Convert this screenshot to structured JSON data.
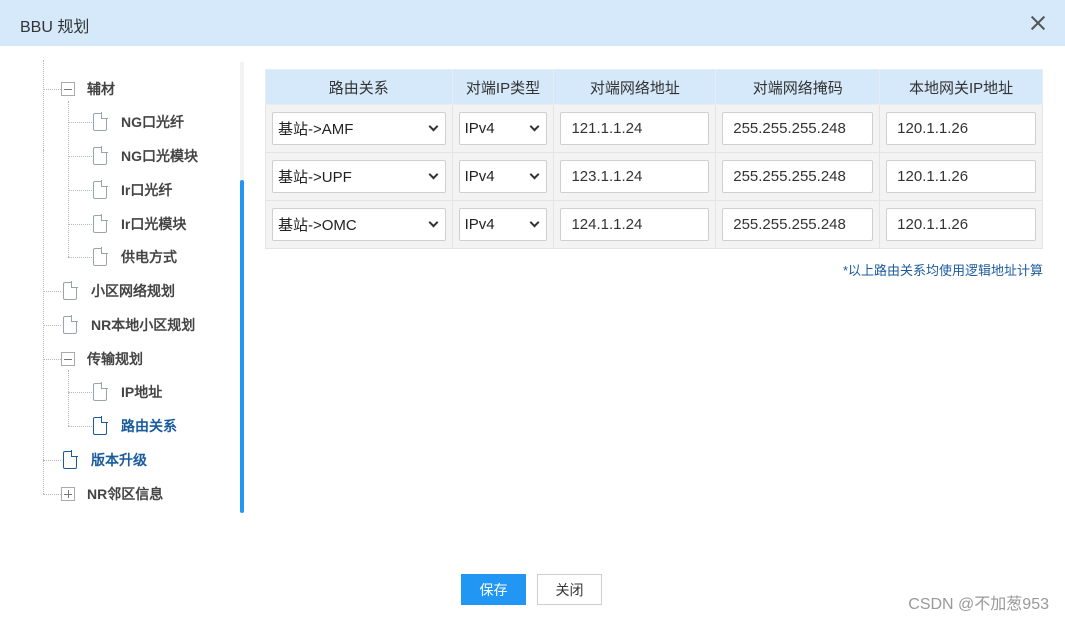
{
  "window": {
    "title": "BBU 规划"
  },
  "tree": {
    "items": [
      {
        "label": "辅材"
      },
      {
        "label": "NG口光纤"
      },
      {
        "label": "NG口光模块"
      },
      {
        "label": "Ir口光纤"
      },
      {
        "label": "Ir口光模块"
      },
      {
        "label": "供电方式"
      },
      {
        "label": "小区网络规划"
      },
      {
        "label": "NR本地小区规划"
      },
      {
        "label": "传输规划"
      },
      {
        "label": "IP地址"
      },
      {
        "label": "路由关系"
      },
      {
        "label": "版本升级"
      },
      {
        "label": "NR邻区信息"
      }
    ]
  },
  "table": {
    "headers": [
      "路由关系",
      "对端IP类型",
      "对端网络地址",
      "对端网络掩码",
      "本地网关IP地址"
    ],
    "rows": [
      {
        "route": "基站->AMF",
        "ip_type": "IPv4",
        "peer_addr": "121.1.1.24",
        "peer_mask": "255.255.255.248",
        "gateway": "120.1.1.26"
      },
      {
        "route": "基站->UPF",
        "ip_type": "IPv4",
        "peer_addr": "123.1.1.24",
        "peer_mask": "255.255.255.248",
        "gateway": "120.1.1.26"
      },
      {
        "route": "基站->OMC",
        "ip_type": "IPv4",
        "peer_addr": "124.1.1.24",
        "peer_mask": "255.255.255.248",
        "gateway": "120.1.1.26"
      }
    ],
    "note": "*以上路由关系均使用逻辑地址计算"
  },
  "footer": {
    "save_label": "保存",
    "close_label": "关闭"
  },
  "watermark": "CSDN @不加葱953",
  "colors": {
    "header_bg": "#d5e9fb",
    "accent": "#2196f3",
    "link": "#1a5b9e"
  }
}
